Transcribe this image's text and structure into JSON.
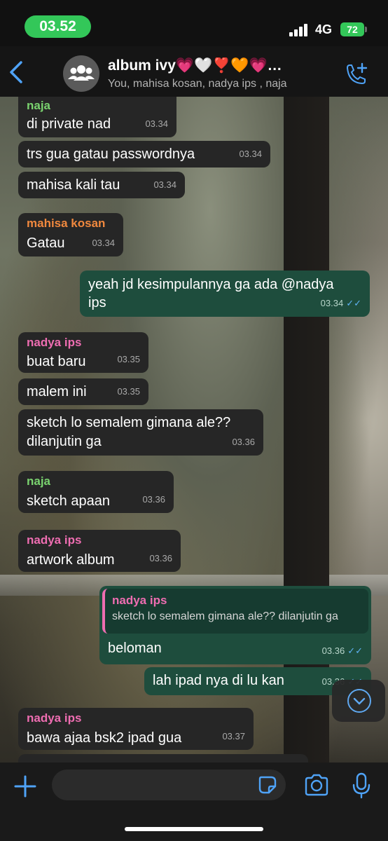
{
  "status": {
    "time": "03.52",
    "network": "4G",
    "battery": "72"
  },
  "header": {
    "title": "album ivy💗🤍❣️🧡💗…",
    "subtitle": "You, mahisa kosan, nadya ips , naja"
  },
  "messages": [
    {
      "sender": "naja",
      "text": "di private nad",
      "time": "03.34"
    },
    {
      "text": "trs gua gatau passwordnya",
      "time": "03.34"
    },
    {
      "text": "mahisa kali tau",
      "time": "03.34"
    },
    {
      "sender": "mahisa kosan",
      "text": "Gatau",
      "time": "03.34"
    },
    {
      "text_line1": "yeah jd kesimpulannya ga ada @nadya",
      "text_line2": "ips",
      "time": "03.34",
      "ticks": "✓✓"
    },
    {
      "sender": "nadya ips",
      "text": "buat baru",
      "time": "03.35"
    },
    {
      "text": "malem ini",
      "time": "03.35"
    },
    {
      "text_line1": "sketch lo semalem gimana ale??",
      "text_line2": "dilanjutin ga",
      "time": "03.36"
    },
    {
      "sender": "naja",
      "text": "sketch apaan",
      "time": "03.36"
    },
    {
      "sender": "nadya ips",
      "text": "artwork album",
      "time": "03.36"
    },
    {
      "quote_sender": "nadya ips",
      "quote_text": "sketch lo semalem gimana ale?? dilanjutin ga",
      "text": "beloman",
      "time": "03.36",
      "ticks": "✓✓"
    },
    {
      "text": "lah ipad nya di lu kan",
      "time": "03.36",
      "ticks": "✓✓"
    },
    {
      "sender": "nadya ips",
      "text": "bawa ajaa bsk2 ipad gua",
      "time": "03.37"
    }
  ],
  "icons": {
    "back": "chevron-left-icon",
    "avatar": "group-icon",
    "call": "add-call-icon",
    "scroll": "chevron-down-icon",
    "plus": "plus-icon",
    "sticker": "sticker-icon",
    "camera": "camera-icon",
    "mic": "microphone-icon"
  },
  "colors": {
    "accent": "#4fa3f7",
    "outgoing": "#1e4d3d",
    "incoming": "#262626",
    "status_green": "#33c759"
  }
}
